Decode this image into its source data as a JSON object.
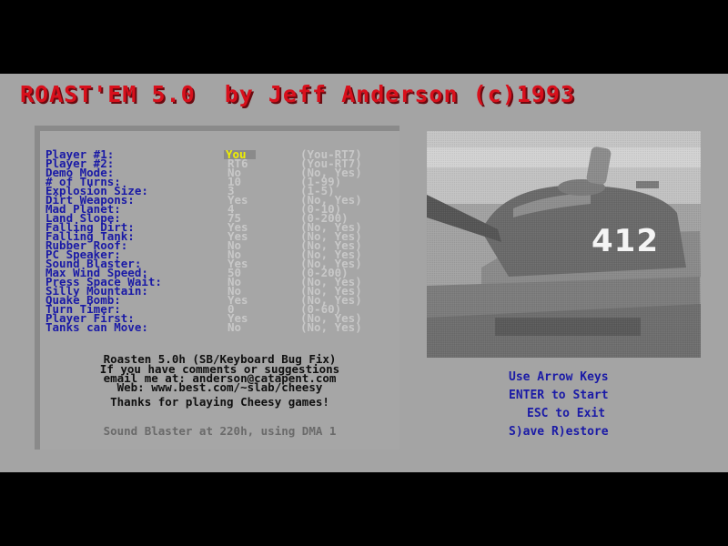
{
  "title": "ROAST'EM 5.0  by Jeff Anderson (c)1993",
  "options": [
    {
      "label": "Player #1:",
      "value": "You",
      "range": "(You-RT7)",
      "selected": true
    },
    {
      "label": "Player #2:",
      "value": "RT6",
      "range": "(You-RT7)"
    },
    {
      "label": "Demo Mode:",
      "value": "No",
      "range": "(No, Yes)"
    },
    {
      "label": "# of Turns:",
      "value": "10",
      "range": "(1-99)"
    },
    {
      "label": "Explosion Size:",
      "value": "3",
      "range": "(1-5)"
    },
    {
      "label": "Dirt Weapons:",
      "value": "Yes",
      "range": "(No, Yes)"
    },
    {
      "label": "Mad Planet:",
      "value": "4",
      "range": "(0-10)"
    },
    {
      "label": "Land Slope:",
      "value": "75",
      "range": "(0-200)"
    },
    {
      "label": "Falling Dirt:",
      "value": "Yes",
      "range": "(No, Yes)"
    },
    {
      "label": "Falling Tank:",
      "value": "Yes",
      "range": "(No, Yes)"
    },
    {
      "label": "Rubber Roof:",
      "value": "No",
      "range": "(No, Yes)"
    },
    {
      "label": "PC Speaker:",
      "value": "No",
      "range": "(No, Yes)"
    },
    {
      "label": "Sound Blaster:",
      "value": "Yes",
      "range": "(No, Yes)"
    },
    {
      "label": "Max Wind Speed:",
      "value": "50",
      "range": "(0-200)"
    },
    {
      "label": "Press Space Wait:",
      "value": "No",
      "range": "(No, Yes)"
    },
    {
      "label": "Silly Mountain:",
      "value": "No",
      "range": "(No, Yes)"
    },
    {
      "label": "Quake Bomb:",
      "value": "Yes",
      "range": "(No, Yes)"
    },
    {
      "label": "Turn Timer:",
      "value": "0",
      "range": "(0-60)"
    },
    {
      "label": "Player First:",
      "value": "Yes",
      "range": "(No, Yes)"
    },
    {
      "label": "Tanks can Move:",
      "value": "No",
      "range": "(No, Yes)"
    }
  ],
  "info": {
    "line1": "Roasten 5.0h (SB/Keyboard Bug Fix)",
    "line2": "If you have comments or suggestions",
    "line3": "email me at: anderson@catapent.com",
    "line4": "Web: www.best.com/~slab/cheesy",
    "line5": "Thanks for playing Cheesy games!",
    "sound_status": "Sound Blaster at 220h, using DMA 1"
  },
  "tank_image": {
    "turret_number": "412"
  },
  "controls": {
    "arrows": "Use Arrow Keys",
    "enter": "ENTER to Start",
    "esc": "ESC to Exit",
    "save": "S)ave R)estore"
  }
}
